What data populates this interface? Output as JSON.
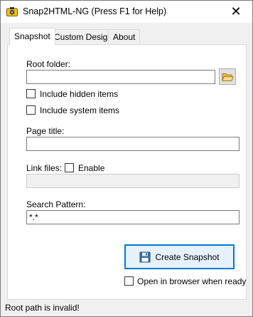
{
  "window": {
    "title": "Snap2HTML-NG (Press F1 for Help)",
    "close_glyph": "✕"
  },
  "tabs": [
    {
      "label": "Snapshot",
      "active": true
    },
    {
      "label": "Custom Design",
      "active": false
    },
    {
      "label": "About",
      "active": false
    }
  ],
  "snapshot": {
    "root_folder_label": "Root folder:",
    "root_folder_value": "",
    "include_hidden_label": "Include hidden items",
    "include_hidden_checked": false,
    "include_system_label": "Include system items",
    "include_system_checked": false,
    "page_title_label": "Page title:",
    "page_title_value": "",
    "link_files_label": "Link files:",
    "link_files_enable_label": "Enable",
    "link_files_enabled": false,
    "link_files_value": "",
    "search_pattern_label": "Search Pattern:",
    "search_pattern_value": "*.*",
    "create_button_label": "Create Snapshot",
    "open_browser_label": "Open in browser when ready",
    "open_browser_checked": false
  },
  "status": {
    "text": "Root path is invalid!"
  },
  "colors": {
    "accent": "#0078d7",
    "folder_icon": "#e8b64c"
  }
}
